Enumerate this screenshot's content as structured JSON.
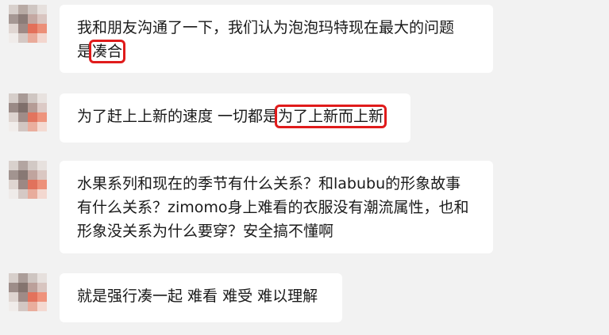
{
  "chat": {
    "messages": [
      {
        "lines": [
          [
            "我和朋友沟通了一下，我们认为泡泡玛特现在最大的问题"
          ],
          [
            "是",
            "凑合"
          ]
        ]
      },
      {
        "lines": [
          [
            "为了赶上上新的速度 一切都是",
            "为了上新而上新"
          ]
        ]
      },
      {
        "lines": [
          [
            "水果系列和现在的季节有什么关系？和labubu的形象故事"
          ],
          [
            "有什么关系？zimomo身上难看的衣服没有潮流属性，也和"
          ],
          [
            "形象没关系为什么要穿？安全搞不懂啊"
          ]
        ]
      },
      {
        "lines": [
          [
            "就是强行凑一起 难看 难受 难以理解"
          ]
        ]
      }
    ],
    "colors": {
      "background": "#f2f2f2",
      "bubble": "#ffffff",
      "text": "#1a1a1a",
      "highlight": "#e01b1b"
    }
  }
}
